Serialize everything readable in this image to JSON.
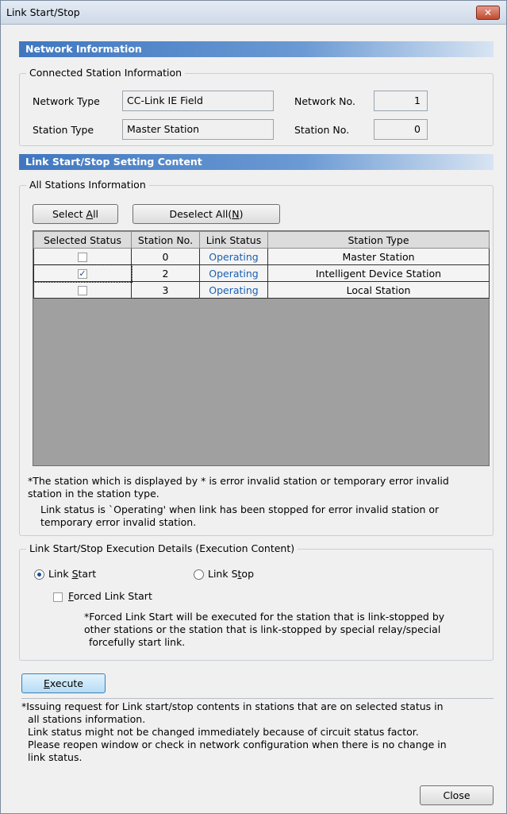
{
  "window": {
    "title": "Link Start/Stop",
    "close_glyph": "✕"
  },
  "network_info": {
    "header": "Network Information",
    "group_title": "Connected Station Information",
    "network_type_label": "Network Type",
    "network_type_value": "CC-Link IE Field",
    "network_no_label": "Network No.",
    "network_no_value": "1",
    "station_type_label": "Station Type",
    "station_type_value": "Master Station",
    "station_no_label": "Station No.",
    "station_no_value": "0"
  },
  "setting": {
    "header": "Link Start/Stop Setting Content",
    "group_title": "All Stations Information",
    "select_all_pre": "Select ",
    "select_all_key": "A",
    "select_all_post": "ll",
    "deselect_all_pre": "Deselect All(",
    "deselect_all_key": "N",
    "deselect_all_post": ")",
    "columns": [
      "Selected Status",
      "Station No.",
      "Link Status",
      "Station Type"
    ],
    "rows": [
      {
        "checked": false,
        "station_no": "0",
        "link_status": "Operating",
        "station_type": "Master Station"
      },
      {
        "checked": true,
        "station_no": "2",
        "link_status": "Operating",
        "station_type": "Intelligent Device Station"
      },
      {
        "checked": false,
        "station_no": "3",
        "link_status": "Operating",
        "station_type": "Local Station"
      }
    ],
    "note1_line1": "*The station which is displayed by * is error invalid station or temporary error invalid",
    "note1_line2": "station in the station type.",
    "note2_line1": "Link status is `Operating' when link has been stopped for error invalid station or",
    "note2_line2": "temporary error invalid station."
  },
  "execution": {
    "group_title": "Link Start/Stop Execution Details (Execution Content)",
    "link_start_pre": "Link ",
    "link_start_key": "S",
    "link_start_post": "tart",
    "link_stop_pre": "Link S",
    "link_stop_key": "t",
    "link_stop_post": "op",
    "link_start_selected": true,
    "forced_pre": "",
    "forced_key": "F",
    "forced_post": "orced Link Start",
    "forced_checked": false,
    "forced_note_line1": "*Forced Link Start will be executed for the station that is link-stopped by",
    "forced_note_line2": "other stations or the station that is link-stopped by special relay/special",
    "forced_note_line3": "forcefully start link."
  },
  "execute_button": {
    "pre": "",
    "key": "E",
    "post": "xecute"
  },
  "footer_notes": {
    "line1": "*Issuing request for Link start/stop contents in stations that are on selected status in",
    "line2": "all stations information.",
    "line3": "Link status might not be changed immediately because of circuit status factor.",
    "line4": "Please reopen window or check in network configuration when there is no change in",
    "line5": "link status."
  },
  "close_button": "Close"
}
